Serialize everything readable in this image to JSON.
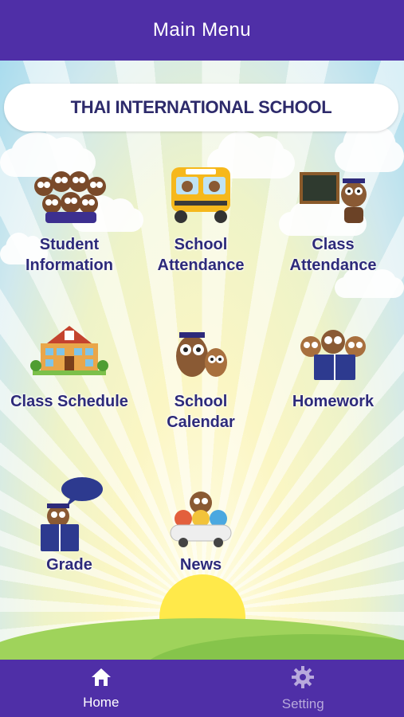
{
  "app_bar": {
    "title": "Main Menu"
  },
  "banner": {
    "title": "THAI INTERNATIONAL SCHOOL"
  },
  "menu": {
    "student_information": "Student\nInformation",
    "school_attendance": "School\nAttendance",
    "class_attendance": "Class\nAttendance",
    "class_schedule": "Class Schedule",
    "school_calendar": "School\nCalendar",
    "homework": "Homework",
    "grade": "Grade",
    "news": "News"
  },
  "bottom_nav": {
    "home": {
      "label": "Home",
      "icon": "home-icon",
      "active": true
    },
    "setting": {
      "label": "Setting",
      "icon": "gear-icon",
      "active": false
    }
  },
  "colors": {
    "primary": "#4f2fa7",
    "label": "#2d2a7a",
    "inactive_nav": "#b8a9dc"
  }
}
